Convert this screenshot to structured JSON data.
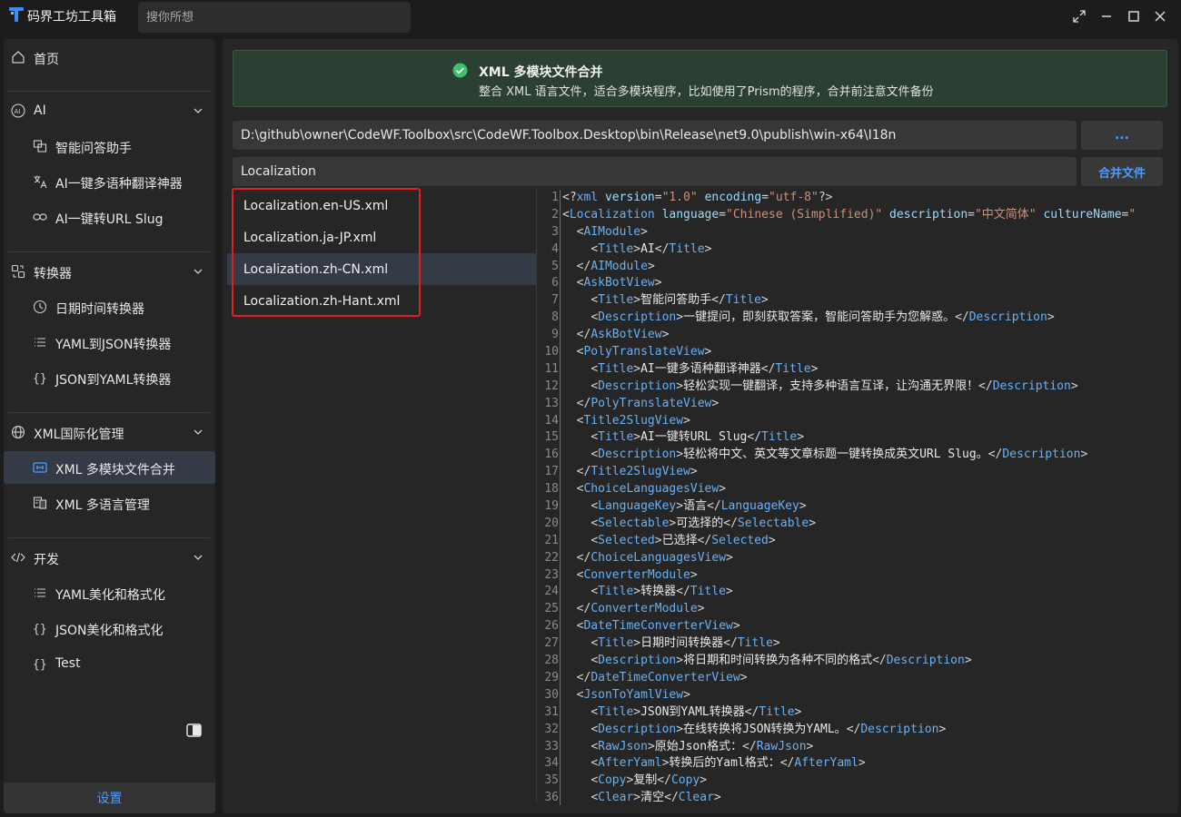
{
  "app": {
    "title": "码界工坊工具箱",
    "search_placeholder": "搜你所想"
  },
  "sidebar": {
    "home": "首页",
    "groups": [
      {
        "label": "AI",
        "items": [
          "智能问答助手",
          "AI一键多语种翻译神器",
          "AI一键转URL Slug"
        ]
      },
      {
        "label": "转换器",
        "items": [
          "日期时间转换器",
          "YAML到JSON转换器",
          "JSON到YAML转换器"
        ]
      },
      {
        "label": "XML国际化管理",
        "items": [
          "XML 多模块文件合并",
          "XML 多语言管理"
        ]
      },
      {
        "label": "开发",
        "items": [
          "YAML美化和格式化",
          "JSON美化和格式化",
          "Test"
        ]
      }
    ],
    "active_item": "XML 多模块文件合并",
    "settings": "设置"
  },
  "banner": {
    "title": "XML 多模块文件合并",
    "description": "整合 XML 语言文件，适合多模块程序，比如使用了Prism的程序，合并前注意文件备份"
  },
  "form": {
    "path_value": "D:\\github\\owner\\CodeWF.Toolbox\\src\\CodeWF.Toolbox.Desktop\\bin\\Release\\net9.0\\publish\\win-x64\\I18n",
    "browse_label": "...",
    "name_value": "Localization",
    "merge_label": "合并文件"
  },
  "files": [
    "Localization.en-US.xml",
    "Localization.ja-JP.xml",
    "Localization.zh-CN.xml",
    "Localization.zh-Hant.xml"
  ],
  "selected_file": "Localization.zh-CN.xml",
  "editor": {
    "line_numbers": [
      "1",
      "2",
      "3",
      "4",
      "5",
      "6",
      "7",
      "8",
      "9",
      "10",
      "11",
      "12",
      "13",
      "14",
      "15",
      "16",
      "17",
      "18",
      "19",
      "20",
      "21",
      "22",
      "23",
      "24",
      "25",
      "26",
      "27",
      "28",
      "29",
      "30",
      "31",
      "32",
      "33",
      "34",
      "35",
      "36"
    ],
    "lines": [
      "<?xml version=\"1.0\" encoding=\"utf-8\"?>",
      "<Localization language=\"Chinese (Simplified)\" description=\"中文简体\" cultureName=\"",
      "  <AIModule>",
      "    <Title>AI</Title>",
      "  </AIModule>",
      "  <AskBotView>",
      "    <Title>智能问答助手</Title>",
      "    <Description>一键提问，即刻获取答案，智能问答助手为您解惑。</Description>",
      "  </AskBotView>",
      "  <PolyTranslateView>",
      "    <Title>AI一键多语种翻译神器</Title>",
      "    <Description>轻松实现一键翻译，支持多种语言互译，让沟通无界限！</Description>",
      "  </PolyTranslateView>",
      "  <Title2SlugView>",
      "    <Title>AI一键转URL Slug</Title>",
      "    <Description>轻松将中文、英文等文章标题一键转换成英文URL Slug。</Description>",
      "  </Title2SlugView>",
      "  <ChoiceLanguagesView>",
      "    <LanguageKey>语言</LanguageKey>",
      "    <Selectable>可选择的</Selectable>",
      "    <Selected>已选择</Selected>",
      "  </ChoiceLanguagesView>",
      "  <ConverterModule>",
      "    <Title>转换器</Title>",
      "  </ConverterModule>",
      "  <DateTimeConverterView>",
      "    <Title>日期时间转换器</Title>",
      "    <Description>将日期和时间转换为各种不同的格式</Description>",
      "  </DateTimeConverterView>",
      "  <JsonToYamlView>",
      "    <Title>JSON到YAML转换器</Title>",
      "    <Description>在线转换将JSON转换为YAML。</Description>",
      "    <RawJson>原始Json格式：</RawJson>",
      "    <AfterYaml>转换后的Yaml格式：</AfterYaml>",
      "    <Copy>复制</Copy>",
      "    <Clear>清空</Clear>"
    ]
  },
  "colors": {
    "accent": "#4f9bff",
    "success": "#3fbf6a",
    "highlight_border": "#e02020",
    "banner_bg": "#2c3f33"
  }
}
